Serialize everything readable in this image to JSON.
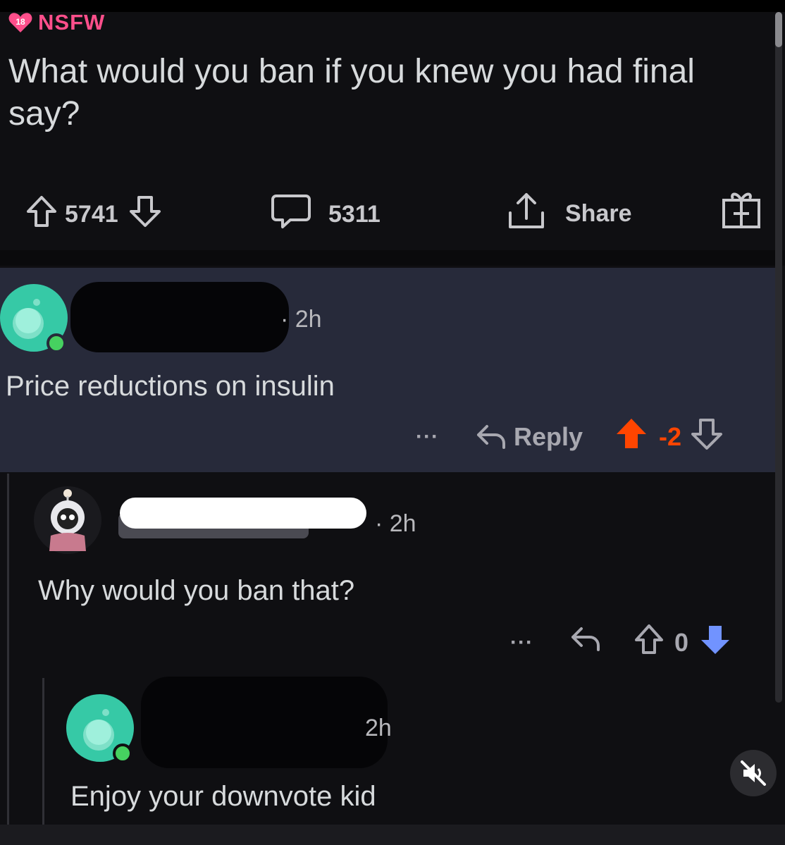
{
  "post": {
    "nsfw_badge": "18",
    "nsfw_label": "NSFW",
    "title": "What would you ban if you knew you had final say?",
    "upvotes": "5741",
    "comments": "5311",
    "share_label": "Share"
  },
  "comments": [
    {
      "time": "· 2h",
      "text": "Price reductions on insulin",
      "reply_label": "Reply",
      "score": "-2",
      "vote_state": "upvoted",
      "more_label": "···"
    },
    {
      "time": "· 2h",
      "text": "Why would you ban that?",
      "score": "0",
      "vote_state": "downvoted",
      "more_label": "···"
    },
    {
      "time": "2h",
      "text": "Enjoy your downvote kid"
    }
  ],
  "colors": {
    "nsfw": "#ff4f8b",
    "upvote": "#ff4500",
    "downvote": "#7193ff",
    "avatar": "#36c9a6",
    "highlight_bg": "#272a3a"
  },
  "icons": [
    "upvote-icon",
    "downvote-icon",
    "comment-icon",
    "share-icon",
    "award-icon",
    "reply-icon",
    "more-icon",
    "mute-icon",
    "snoo-avatar-icon"
  ]
}
